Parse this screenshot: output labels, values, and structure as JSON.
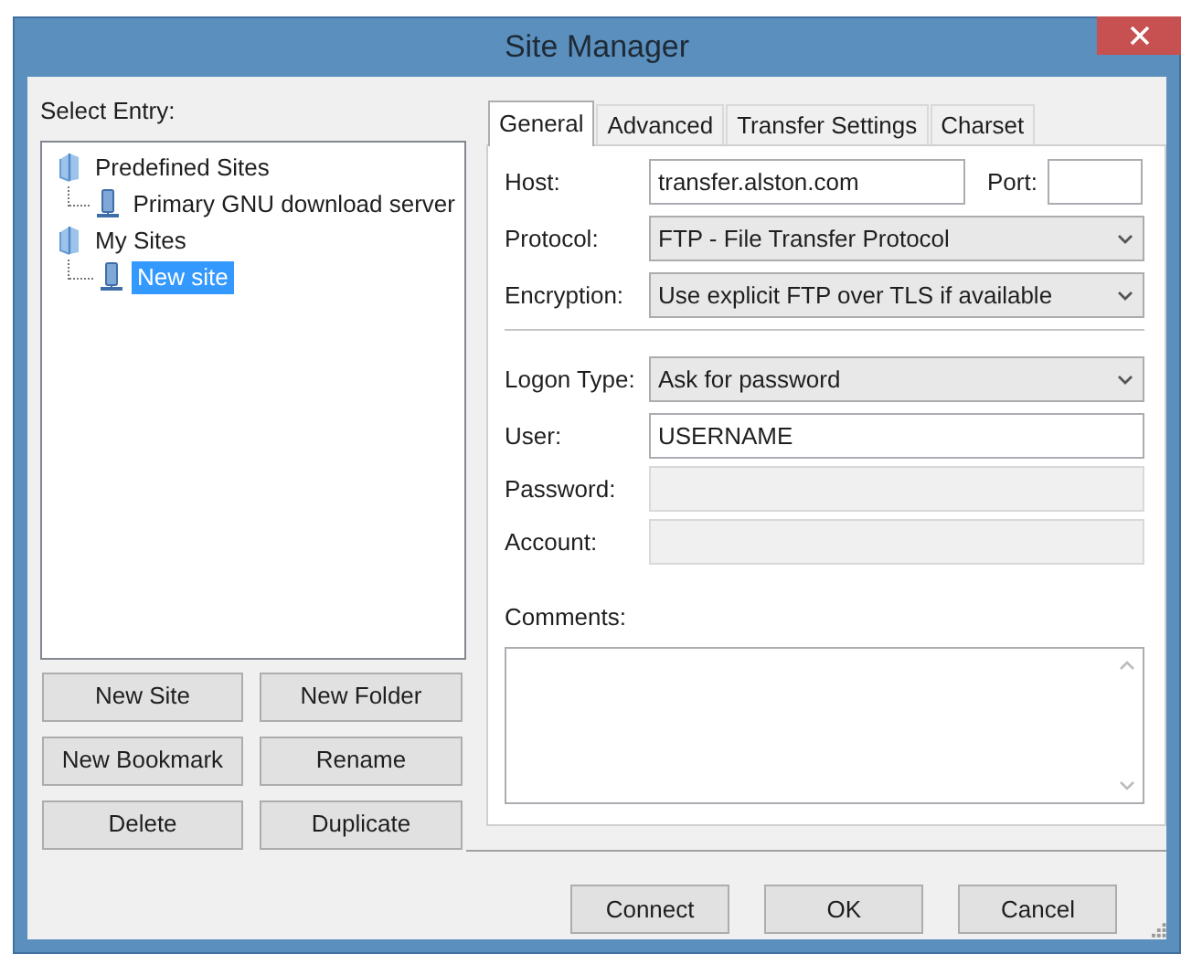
{
  "window": {
    "title": "Site Manager"
  },
  "select_entry_label": "Select Entry:",
  "tree": [
    {
      "label": "Predefined Sites",
      "kind": "folder",
      "selected": false,
      "children": [
        {
          "label": "Primary GNU download server",
          "kind": "site",
          "selected": false
        }
      ]
    },
    {
      "label": "My Sites",
      "kind": "folder",
      "selected": false,
      "children": [
        {
          "label": "New site",
          "kind": "site",
          "selected": true
        }
      ]
    }
  ],
  "site_buttons": [
    "New Site",
    "New Folder",
    "New Bookmark",
    "Rename",
    "Delete",
    "Duplicate"
  ],
  "tabs": [
    {
      "label": "General",
      "selected": true
    },
    {
      "label": "Advanced",
      "selected": false
    },
    {
      "label": "Transfer Settings",
      "selected": false
    },
    {
      "label": "Charset",
      "selected": false
    }
  ],
  "general": {
    "host": {
      "label": "Host:",
      "value": "transfer.alston.com"
    },
    "port": {
      "label": "Port:"
    },
    "protocol": {
      "label": "Protocol:",
      "value": "FTP - File Transfer Protocol"
    },
    "encryption": {
      "label": "Encryption:",
      "value": "Use explicit FTP over TLS if available"
    },
    "logon_type": {
      "label": "Logon Type:",
      "value": "Ask for password"
    },
    "user": {
      "label": "User:",
      "value": "USERNAME",
      "disabled": false
    },
    "password": {
      "label": "Password:",
      "disabled": true
    },
    "account": {
      "label": "Account:",
      "disabled": true
    },
    "comments": {
      "label": "Comments:"
    }
  },
  "dialog_buttons": [
    "Connect",
    "OK",
    "Cancel"
  ]
}
